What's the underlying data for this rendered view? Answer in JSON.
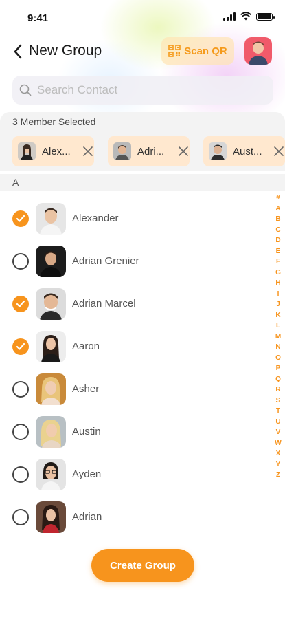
{
  "status": {
    "time": "9:41"
  },
  "header": {
    "title": "New Group",
    "scan_label": "Scan QR"
  },
  "search": {
    "placeholder": "Search Contact"
  },
  "selected": {
    "label": "3 Member Selected",
    "chips": [
      {
        "name": "Alexander",
        "display": "Alex..."
      },
      {
        "name": "Adrian Marcel",
        "display": "Adri..."
      },
      {
        "name": "Austin",
        "display": "Aust..."
      }
    ]
  },
  "section": {
    "letter": "A"
  },
  "contacts": [
    {
      "name": "Alexander",
      "checked": true
    },
    {
      "name": "Adrian Grenier",
      "checked": false
    },
    {
      "name": "Adrian Marcel",
      "checked": true
    },
    {
      "name": "Aaron",
      "checked": true
    },
    {
      "name": "Asher",
      "checked": false
    },
    {
      "name": "Austin",
      "checked": false
    },
    {
      "name": "Ayden",
      "checked": false
    },
    {
      "name": "Adrian",
      "checked": false
    }
  ],
  "alphabet": [
    "#",
    "A",
    "B",
    "C",
    "D",
    "E",
    "F",
    "G",
    "H",
    "I",
    "J",
    "K",
    "L",
    "M",
    "N",
    "O",
    "P",
    "Q",
    "R",
    "S",
    "T",
    "U",
    "V",
    "W",
    "X",
    "Y",
    "Z"
  ],
  "actions": {
    "create_label": "Create Group"
  },
  "colors": {
    "accent": "#f7941d",
    "chip_bg": "#ffe8cf",
    "scan_text": "#f59a1b"
  }
}
